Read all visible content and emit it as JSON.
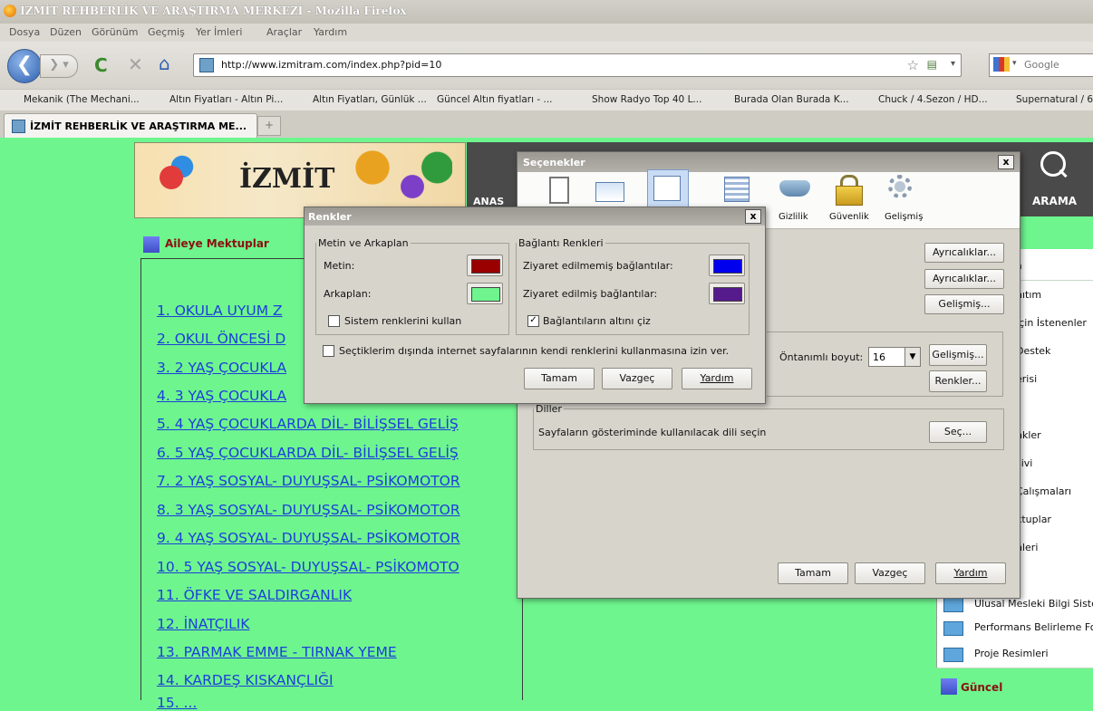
{
  "window": {
    "title": "İZMİT REHBERLİK VE ARAŞTIRMA MERKEZİ - Mozilla Firefox"
  },
  "menu": [
    "Dosya",
    "Düzen",
    "Görünüm",
    "Geçmiş",
    "Yer İmleri",
    "Araçlar",
    "Yardım"
  ],
  "navbar": {
    "url": "http://www.izmitram.com/index.php?pid=10",
    "search_placeholder": "Google"
  },
  "bookmarks": [
    "Mekanik (The Mechani...",
    "Altın Fiyatları - Altın Pi...",
    "Altın Fiyatları, Günlük ...",
    "Güncel Altın fiyatları - ...",
    "Show Radyo Top 40 L...",
    "Burada Olan Burada K...",
    "Chuck / 4.Sezon / HD...",
    "Supernatural / 6"
  ],
  "tab": {
    "label": "İZMİT REHBERLİK VE ARAŞTIRMA ME...",
    "new_tab": "+"
  },
  "site": {
    "logo_text": "İZMİT",
    "nav_left": "ANAS",
    "nav_search": "ARAMA",
    "section_title": "Aileye Mektuplar",
    "links": [
      "1. OKULA UYUM Z",
      "2. OKUL ÖNCESİ D",
      "3. 2 YAŞ ÇOCUKLA",
      "4. 3 YAŞ ÇOCUKLA",
      "5. 4 YAŞ ÇOCUKLARDA DİL- BİLİŞSEL GELİŞ",
      "6. 5 YAŞ ÇOCUKLARDA DİL- BİLİŞSEL GELİŞ",
      "7. 2 YAŞ SOSYAL- DUYUŞSAL- PSİKOMOTOR",
      "8. 3 YAŞ SOSYAL- DUYUŞSAL- PSİKOMOTOR",
      "9. 4 YAŞ SOSYAL- DUYUŞSAL- PSİKOMOTOR",
      "10. 5 YAŞ SOSYAL- DUYUŞSAL- PSİKOMOTO",
      "11. ÖFKE VE SALDIRGANLIK",
      "12. İNATÇILIK",
      "13. PARMAK EMME - TIRNAK YEME",
      "14. KARDEŞ KISKANÇLIĞI",
      "15. ..."
    ],
    "sidebar": [
      "a",
      "nıtım",
      "İçin İstenenler",
      "Destek",
      "erisi",
      "",
      "nkler",
      "sivi",
      "Çalışmaları",
      "ktuplar",
      "nleri",
      "",
      "Ulusal Mesleki Bilgi Sistem",
      "Performans Belirleme For",
      "Proje Resimleri"
    ],
    "sidebar_footer": "Güncel"
  },
  "options_dialog": {
    "title": "Seçenekler",
    "close": "x",
    "toolbar": [
      "",
      "",
      "",
      "",
      "Gizlilik",
      "Güvenlik",
      "Gelişmiş"
    ],
    "buttons_right": [
      "Ayrıcalıklar...",
      "Ayrıcalıklar...",
      "Gelişmiş..."
    ],
    "default_size_label": "Öntanımlı boyut:",
    "default_size_value": "16",
    "advanced_btn": "Gelişmiş...",
    "colors_btn": "Renkler...",
    "languages_group": "Diller",
    "languages_text": "Sayfaların gösteriminde kullanılacak dili seçin",
    "choose_btn": "Seç...",
    "ok": "Tamam",
    "cancel": "Vazgeç",
    "help": "Yardım"
  },
  "colors_dialog": {
    "title": "Renkler",
    "close": "x",
    "text_bg_group": "Metin ve Arkaplan",
    "text_label": "Metin:",
    "bg_label": "Arkaplan:",
    "system_colors": "Sistem renklerini kullan",
    "link_colors_group": "Bağlantı Renkleri",
    "unvisited_label": "Ziyaret edilmemiş bağlantılar:",
    "visited_label": "Ziyaret edilmiş bağlantılar:",
    "underline_label": "Bağlantıların altını çiz",
    "allow_pages": "Seçtiklerim dışında internet sayfalarının kendi renklerini kullanmasına izin ver.",
    "ok": "Tamam",
    "cancel": "Vazgeç",
    "help": "Yardım",
    "colors": {
      "text": "#990000",
      "background": "#6ef58e",
      "unvisited": "#0000ee",
      "visited": "#551a8b"
    }
  }
}
